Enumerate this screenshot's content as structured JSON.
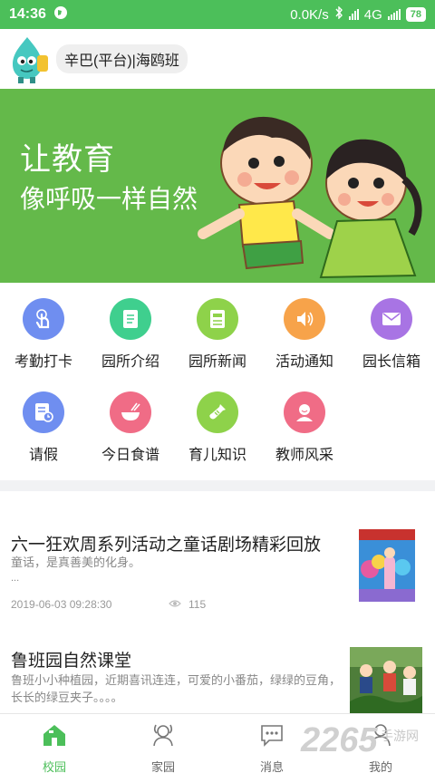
{
  "status_bar": {
    "time": "14:36",
    "network_speed": "0.0K/s",
    "network_type": "4G",
    "battery": "78"
  },
  "header": {
    "class_name": "辛巴(平台)|海鸥班"
  },
  "banner": {
    "line1": "让教育",
    "line2": "像呼吸一样自然"
  },
  "shortcuts": [
    {
      "label": "考勤打卡",
      "icon": "tap-hand-icon",
      "color": "#6f8ef0"
    },
    {
      "label": "园所介绍",
      "icon": "document-icon",
      "color": "#3fcf8e"
    },
    {
      "label": "园所新闻",
      "icon": "newspaper-icon",
      "color": "#8ed24a"
    },
    {
      "label": "活动通知",
      "icon": "speaker-icon",
      "color": "#f7a34a"
    },
    {
      "label": "园长信箱",
      "icon": "mail-icon",
      "color": "#a874e4"
    },
    {
      "label": "请假",
      "icon": "leave-form-icon",
      "color": "#6f8ef0"
    },
    {
      "label": "今日食谱",
      "icon": "bowl-icon",
      "color": "#f06c86"
    },
    {
      "label": "育儿知识",
      "icon": "bottle-icon",
      "color": "#8ed24a"
    },
    {
      "label": "教师风采",
      "icon": "teacher-icon",
      "color": "#f06c86"
    }
  ],
  "news": [
    {
      "title": "六一狂欢周系列活动之童话剧场精彩回放",
      "summary": "童话，是真善美的化身。",
      "summary_more": "...",
      "datetime": "2019-06-03 09:28:30",
      "views": "115"
    },
    {
      "title": "鲁班园自然课堂",
      "summary": "鲁班小小种植园，近期喜讯连连，可爱的小番茄，绿绿的豆角，长长的绿豆夹子。。。。"
    }
  ],
  "bottom_nav": [
    {
      "label": "校园",
      "icon": "school-icon",
      "active": true
    },
    {
      "label": "家园",
      "icon": "family-icon",
      "active": false
    },
    {
      "label": "消息",
      "icon": "message-icon",
      "active": false
    },
    {
      "label": "我的",
      "icon": "profile-icon",
      "active": false
    }
  ],
  "watermark": {
    "number": "2265",
    "text": "手游网"
  },
  "colors": {
    "brand_green": "#4cbf5a",
    "banner_green": "#64b94a"
  }
}
